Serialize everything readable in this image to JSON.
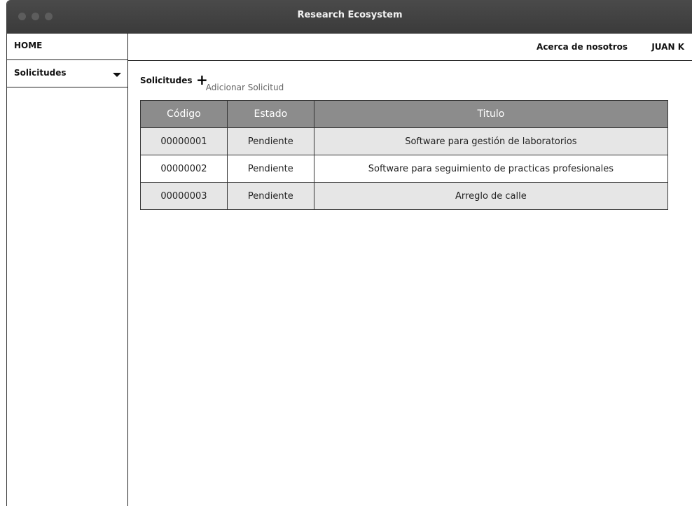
{
  "window": {
    "title": "Research Ecosystem"
  },
  "sidebar": {
    "home_label": "HOME",
    "menu_label": "Solicitudes"
  },
  "topnav": {
    "about_label": "Acerca de nosotros",
    "user_label": "JUAN K"
  },
  "main": {
    "section_title": "Solicitudes",
    "add_label": "Adicionar Solicitud",
    "table": {
      "headers": [
        "Código",
        "Estado",
        "Titulo"
      ],
      "rows": [
        [
          "00000001",
          "Pendiente",
          "Software para gestión de laboratorios"
        ],
        [
          "00000002",
          "Pendiente",
          "Software para seguimiento de practicas profesionales"
        ],
        [
          "00000003",
          "Pendiente",
          "Arreglo de calle"
        ]
      ]
    }
  },
  "colors": {
    "titlebar": "#3b3b3b",
    "table_header": "#8c8c8c",
    "row_shade": "#e6e6e6"
  }
}
